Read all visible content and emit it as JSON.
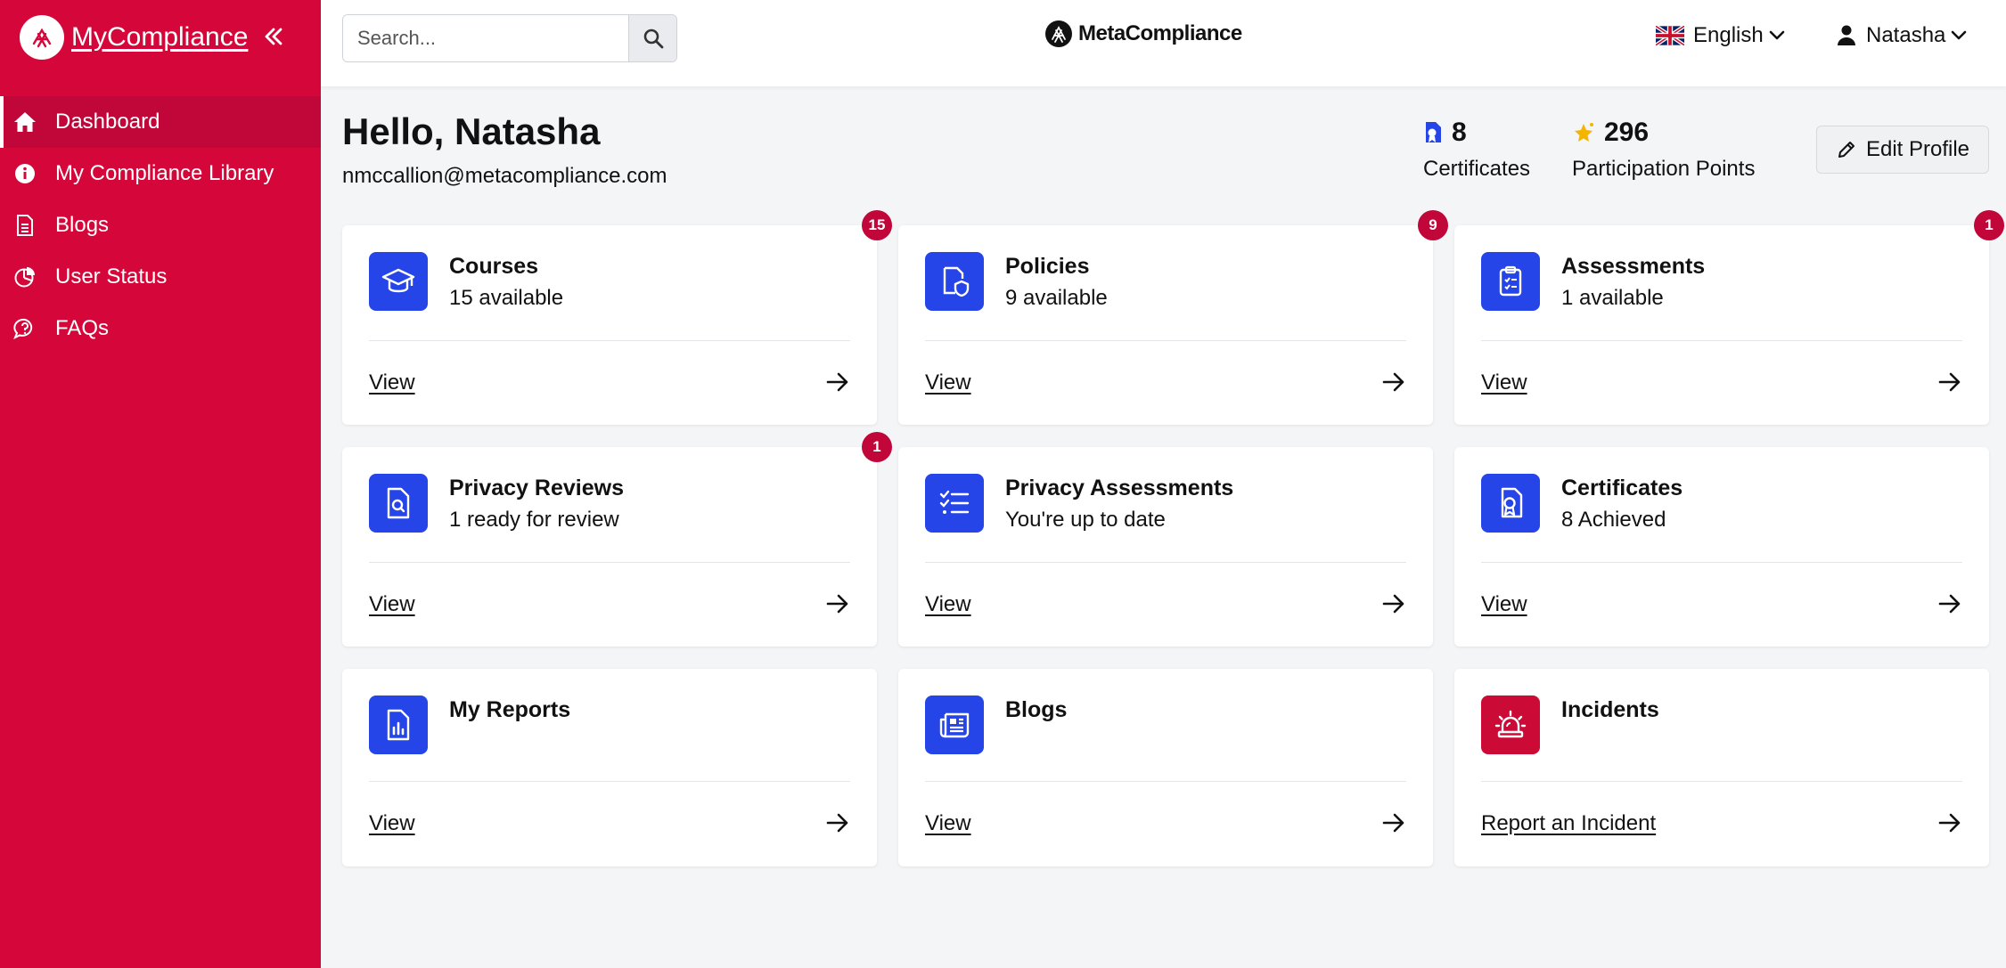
{
  "app": {
    "brand_name": "MyCompliance",
    "top_logo_text": "MetaCompliance"
  },
  "sidebar": {
    "items": [
      {
        "label": "Dashboard",
        "icon": "home-icon",
        "active": true
      },
      {
        "label": "My Compliance Library",
        "icon": "info-icon",
        "active": false
      },
      {
        "label": "Blogs",
        "icon": "document-icon",
        "active": false
      },
      {
        "label": "User Status",
        "icon": "pie-chart-icon",
        "active": false
      },
      {
        "label": "FAQs",
        "icon": "help-bubble-icon",
        "active": false
      }
    ]
  },
  "header": {
    "search_placeholder": "Search...",
    "language": "English",
    "user_name": "Natasha"
  },
  "profile": {
    "greeting": "Hello, Natasha",
    "email": "nmccallion@metacompliance.com",
    "certificates_value": "8",
    "certificates_label": "Certificates",
    "points_value": "296",
    "points_label": "Participation Points",
    "edit_label": "Edit Profile"
  },
  "cards": [
    {
      "title": "Courses",
      "subtitle": "15 available",
      "link": "View",
      "badge": "15",
      "icon": "graduation-cap-icon"
    },
    {
      "title": "Policies",
      "subtitle": "9 available",
      "link": "View",
      "badge": "9",
      "icon": "policy-shield-icon"
    },
    {
      "title": "Assessments",
      "subtitle": "1 available",
      "link": "View",
      "badge": "1",
      "icon": "clipboard-check-icon"
    },
    {
      "title": "Privacy Reviews",
      "subtitle": "1 ready for review",
      "link": "View",
      "badge": "1",
      "icon": "document-search-icon"
    },
    {
      "title": "Privacy Assessments",
      "subtitle": "You're up to date",
      "link": "View",
      "badge": "",
      "icon": "checklist-icon"
    },
    {
      "title": "Certificates",
      "subtitle": "8 Achieved",
      "link": "View",
      "badge": "",
      "icon": "certificate-icon"
    },
    {
      "title": "My Reports",
      "subtitle": "",
      "link": "View",
      "badge": "",
      "icon": "report-chart-icon"
    },
    {
      "title": "Blogs",
      "subtitle": "",
      "link": "View",
      "badge": "",
      "icon": "newspaper-icon"
    },
    {
      "title": "Incidents",
      "subtitle": "",
      "link": "Report an Incident",
      "badge": "",
      "icon": "siren-icon"
    }
  ],
  "colors": {
    "brand_red": "#d5073a",
    "active_red": "#c1063a",
    "icon_blue": "#2545e8",
    "incident_red": "#cc0a36"
  }
}
